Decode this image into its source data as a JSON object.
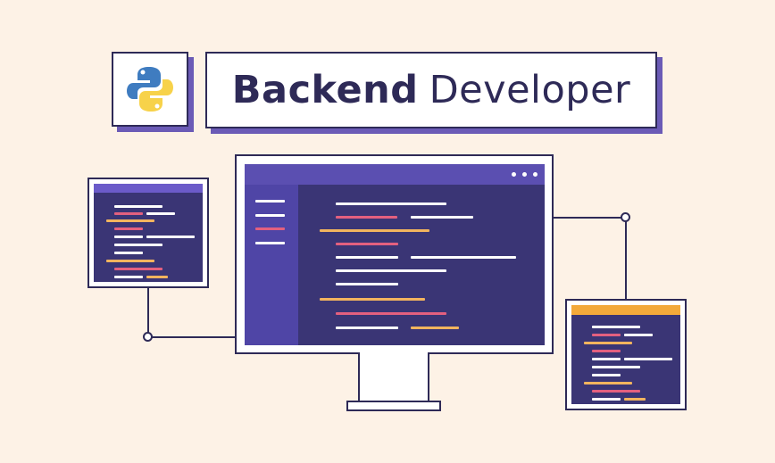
{
  "header": {
    "title_bold": "Backend",
    "title_regular": "Developer"
  },
  "icons": {
    "logo": "python-logo-icon"
  },
  "colors": {
    "background": "#fdf2e6",
    "outline": "#2e2a57",
    "shadow": "#6b5bb6",
    "screen": "#3a3575",
    "screen_bar": "#5b4fb1",
    "sidebar": "#4f45a6",
    "code_white": "#ffffff",
    "code_pink": "#e3607f",
    "code_orange": "#f2b45e",
    "python_blue": "#3f7cc0",
    "python_yellow": "#f7d24a"
  }
}
